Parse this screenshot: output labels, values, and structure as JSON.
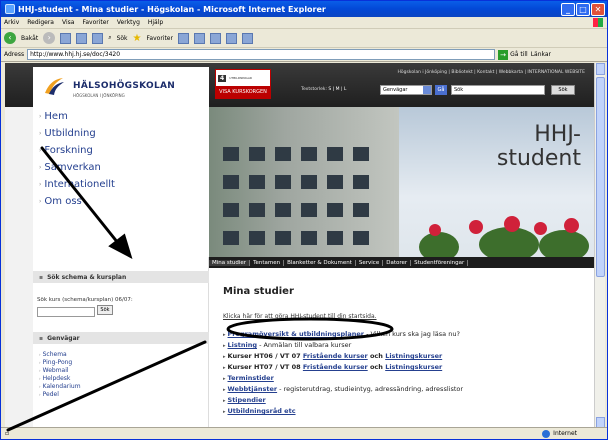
{
  "window": {
    "title": "HHJ-student - Mina studier - Högskolan - Microsoft Internet Explorer",
    "menus": [
      "Arkiv",
      "Redigera",
      "Visa",
      "Favoriter",
      "Verktyg",
      "Hjälp"
    ]
  },
  "toolbar": {
    "back_label": "Bakåt",
    "search_label": "Sök",
    "favorites_label": "Favoriter"
  },
  "addressbar": {
    "label": "Adress",
    "url": "http://www.hhj.hj.se/doc/3420",
    "go_label": "Gå till",
    "links_label": "Länkar"
  },
  "statusbar": {
    "zone": "Internet"
  },
  "header": {
    "logo_name": "HÄLSOHÖGSKOLAN",
    "logo_sub": "HÖGSKOLAN I JÖNKÖPING",
    "promo_number": "4",
    "promo_label": "UTBILDNINGAR",
    "promo_button": "VISA KURSKORGEN",
    "toplinks": "Högskolan i Jönköping | Bibliotekt | Kontakt | Webbkarta | INTERNATIONAL WEBSITE",
    "textsize_label": "Textstorlek:",
    "textsize_options": "S | M | L",
    "shortcut_value": "Genvägar",
    "ga_label": "Gå",
    "search_value": "Sök",
    "search_button": "Sök"
  },
  "nav": {
    "items": [
      "Hem",
      "Utbildning",
      "Forskning",
      "Samverkan",
      "Internationellt",
      "Om oss"
    ]
  },
  "hero": {
    "title_line1": "HHJ-",
    "title_line2": "student"
  },
  "tabs": [
    "Mina studier",
    "Tentamen",
    "Blanketter & Dokument",
    "Service",
    "Datorer",
    "Studentföreningar"
  ],
  "sidebar": {
    "schema_heading": "Sök schema & kursplan",
    "kurs_label": "Sök kurs (schema/kursplan) 06/07:",
    "kurs_button": "Sök",
    "genvagar_heading": "Genvägar",
    "links": [
      "Schema",
      "Ping-Pong",
      "Webmail",
      "Helpdesk",
      "Kalendarium",
      "Pedel"
    ]
  },
  "main": {
    "title": "Mina studier",
    "intro": "Klicka här för att göra HHJ-student till din startsida.",
    "items": [
      {
        "link": "Programöversikt & utbildningsplaner",
        "rest": " - Vilken kurs ska jag läsa nu?"
      },
      {
        "link": "Listning",
        "rest": " - Anmälan till valbara kurser"
      },
      {
        "prefix": "Kurser HT06 / VT 07 ",
        "link": "Fristående kurser",
        "mid": " och ",
        "link2": "Listningskurser"
      },
      {
        "prefix": "Kurser HT07 / VT 08 ",
        "link": "Fristående kurser",
        "mid": " och ",
        "link2": "Listningskurser"
      },
      {
        "link": "Terminstider"
      },
      {
        "link": "Webbtjänster",
        "rest": " - registerutdrag, studieintyg, adressändring, adresslistor"
      },
      {
        "link": "Stipendier"
      },
      {
        "link": "Utbildningsråd etc"
      }
    ]
  },
  "colors": {
    "link": "#25408f",
    "header_dark": "#1f1f1f",
    "accent_red": "#b00000",
    "annotation": "#000000"
  }
}
